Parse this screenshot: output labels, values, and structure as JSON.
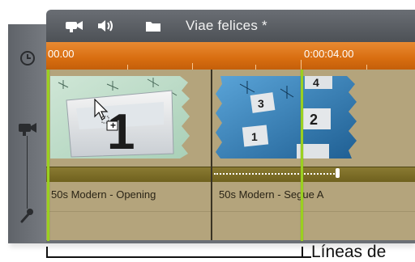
{
  "toolbar": {
    "icons": [
      "video-camera-icon",
      "speaker-icon",
      "folder-icon"
    ],
    "project_title": "Viae felices *"
  },
  "ruler": {
    "start_label": "00.00",
    "mark_label": "0:00:04.00"
  },
  "rail": {
    "icons": [
      "clock-icon",
      "video-camera-icon",
      "microphone-icon"
    ]
  },
  "clips": [
    {
      "label": "50s Modern - Opening",
      "thumbnail_number": "1"
    },
    {
      "label": "50s Modern - Segue A",
      "thumbnail_numbers": [
        "4",
        "3",
        "2",
        "1"
      ]
    }
  ],
  "cursor": {
    "badge": "+"
  },
  "caption": "Líneas de",
  "colors": {
    "ruler": "#d86d10",
    "track": "#b4a47c",
    "playhead": "#9ad020",
    "audio_bar": "#7a6b26"
  }
}
